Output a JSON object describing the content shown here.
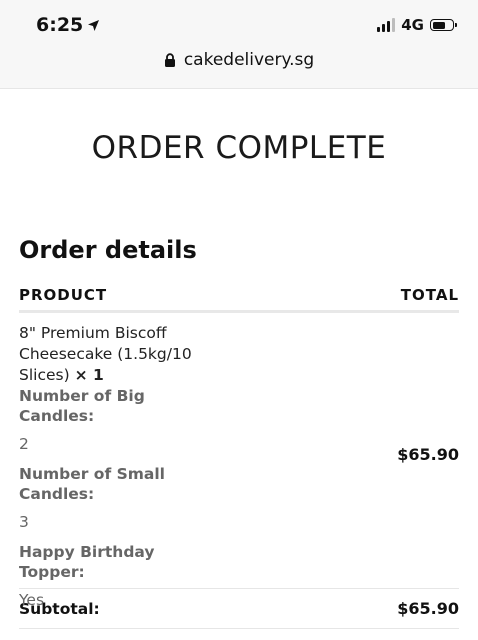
{
  "status_bar": {
    "time": "6:25",
    "network": "4G"
  },
  "browser": {
    "url": "cakedelivery.sg"
  },
  "page": {
    "title": "ORDER COMPLETE",
    "section_title": "Order details"
  },
  "table": {
    "headers": {
      "product": "PRODUCT",
      "total": "TOTAL"
    },
    "item": {
      "name": "8\" Premium Biscoff Cheesecake (1.5kg/10 Slices)",
      "quantity": "× 1",
      "total": "$65.90",
      "meta": [
        {
          "label": "Number of Big Candles:",
          "value": "2"
        },
        {
          "label": "Number of Small Candles:",
          "value": "3"
        },
        {
          "label": "Happy Birthday Topper:",
          "value": "Yes"
        }
      ]
    },
    "subtotal": {
      "label": "Subtotal:",
      "amount": "$65.90"
    }
  },
  "icons": {
    "location_arrow": "location-arrow-icon",
    "signal": "cellular-signal-icon",
    "battery": "battery-icon",
    "lock": "lock-icon"
  }
}
